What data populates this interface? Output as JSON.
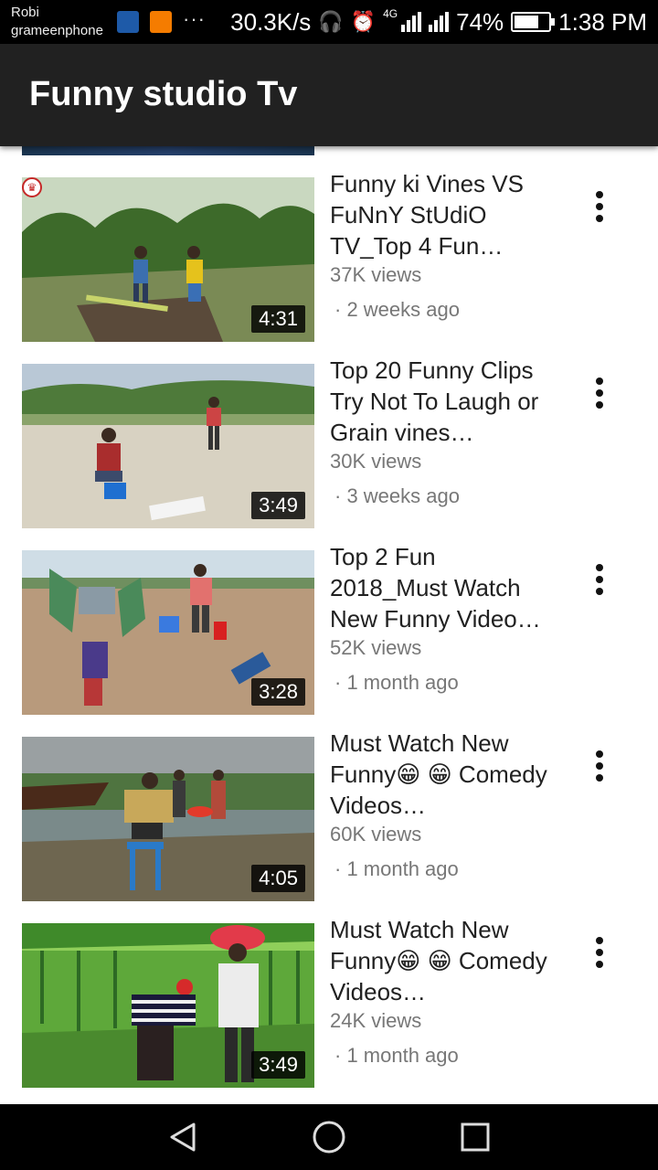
{
  "status_bar": {
    "carrier_line1": "Robi",
    "carrier_line2": "grameenphone",
    "overflow": "···",
    "net_speed": "30.3K/s",
    "network_type": "4G",
    "battery": "74%",
    "battery_level": 0.74,
    "time": "1:38 PM",
    "icons": [
      "app-notification-icon",
      "app-notification-icon-2",
      "headphones-icon",
      "alarm-icon",
      "signal-icon",
      "battery-icon"
    ]
  },
  "app_bar": {
    "title": "Funny studio Tv"
  },
  "videos": [
    {
      "title": "Funny ki Vines VS FuNnY StUdiO TV_Top 4 Fun…",
      "views": "37K views",
      "age": "· 2 weeks ago",
      "duration": "4:31",
      "has_badge": true
    },
    {
      "title": "Top 20 Funny Clips Try Not To Laugh or Grain vines…",
      "views": "30K views",
      "age": "· 3 weeks ago",
      "duration": "3:49"
    },
    {
      "title": "Top 2 Fun 2018_Must Watch New Funny Video…",
      "views": "52K views",
      "age": "· 1 month ago",
      "duration": "3:28"
    },
    {
      "title": "Must Watch New Funny😁 😁 Comedy Videos…",
      "views": "60K views",
      "age": "· 1 month ago",
      "duration": "4:05"
    },
    {
      "title": "Must Watch New Funny😁 😁 Comedy Videos…",
      "views": "24K views",
      "age": "· 1 month ago",
      "duration": "3:49"
    }
  ],
  "nav_bar": {
    "icons": [
      "back-icon",
      "home-icon",
      "recents-icon"
    ]
  },
  "colors": {
    "app_bar": "#212121",
    "text": "#212121",
    "meta": "#777777"
  }
}
